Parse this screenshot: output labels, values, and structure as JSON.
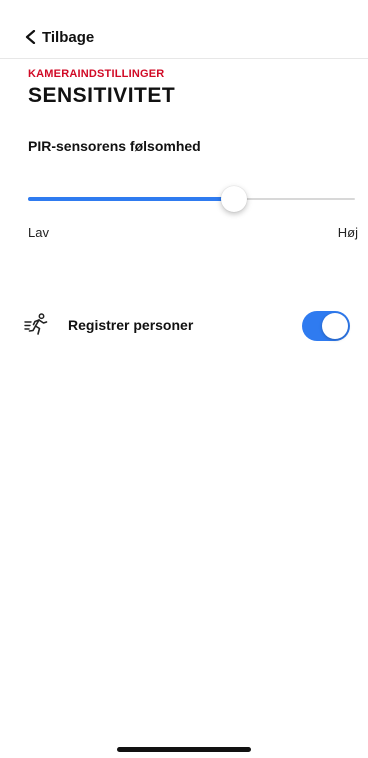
{
  "header": {
    "back_label": "Tilbage",
    "back_icon": "chevron-left-icon"
  },
  "page": {
    "category": "KAMERAINDSTILLINGER",
    "title": "SENSITIVITET"
  },
  "sensitivity": {
    "label": "PIR-sensorens følsomhed",
    "low_label": "Lav",
    "high_label": "Høj",
    "value_fraction": 0.63,
    "accent_color": "#2f7bf0"
  },
  "detect_people": {
    "label": "Registrer personer",
    "icon": "running-person-icon",
    "enabled": true
  }
}
